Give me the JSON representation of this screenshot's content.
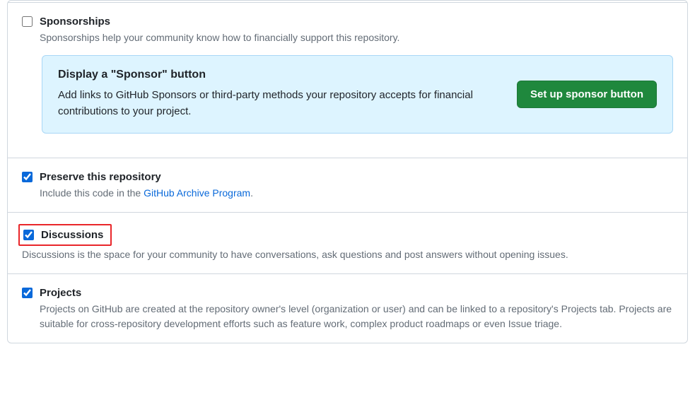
{
  "sponsorships": {
    "checked": false,
    "title": "Sponsorships",
    "desc": "Sponsorships help your community know how to financially support this repository.",
    "callout": {
      "title": "Display a \"Sponsor\" button",
      "desc": "Add links to GitHub Sponsors or third-party methods your repository accepts for financial contributions to your project.",
      "button": "Set up sponsor button"
    }
  },
  "preserve": {
    "checked": true,
    "title": "Preserve this repository",
    "desc_prefix": "Include this code in the ",
    "link_text": "GitHub Archive Program",
    "desc_suffix": "."
  },
  "discussions": {
    "checked": true,
    "title": "Discussions",
    "desc": "Discussions is the space for your community to have conversations, ask questions and post answers without opening issues."
  },
  "projects": {
    "checked": true,
    "title": "Projects",
    "desc": "Projects on GitHub are created at the repository owner's level (organization or user) and can be linked to a repository's Projects tab. Projects are suitable for cross-repository development efforts such as feature work, complex product roadmaps or even Issue triage."
  }
}
